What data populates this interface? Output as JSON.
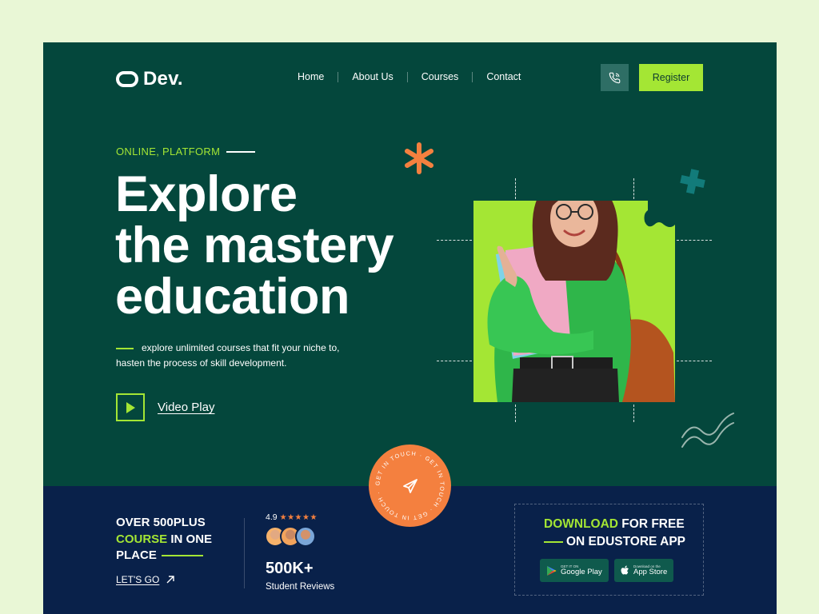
{
  "brand": {
    "name": "Dev."
  },
  "nav": {
    "items": [
      {
        "label": "Home"
      },
      {
        "label": "About Us"
      },
      {
        "label": "Courses"
      },
      {
        "label": "Contact"
      }
    ],
    "register_label": "Register"
  },
  "hero": {
    "eyebrow": "ONLINE, PLATFORM",
    "headline": [
      "Explore",
      "the mastery",
      "education"
    ],
    "subtext_line1": "explore unlimited courses that fit your niche to,",
    "subtext_line2": "hasten the  process of skill development.",
    "video_label": "Video Play",
    "badge_text": "GET IN TOUCH · GET IN TOUCH · GET IN TOUCH ·"
  },
  "stats": {
    "title_line1": "OVER 500PLUS",
    "title_accent": "COURSE",
    "title_rest": " IN ONE",
    "title_line3": "PLACE",
    "cta": "LET'S GO",
    "rating": "4.9",
    "stars": "★★★★★",
    "count": "500K+",
    "count_label": "Student Reviews"
  },
  "download": {
    "accent": "DOWNLOAD",
    "title_rest": " FOR FREE",
    "line2": "ON EDUSTORE APP",
    "google_small": "GET IT ON",
    "google_big": "Google Play",
    "apple_small": "Download on the",
    "apple_big": "App Store"
  },
  "colors": {
    "frame_bg": "#04473c",
    "band_bg": "#09214a",
    "accent_green": "#a4e634",
    "accent_orange": "#f4803f",
    "page_bg": "#e9f7d6"
  },
  "icons": [
    "phone-icon",
    "play-icon",
    "arrow-right-icon",
    "paper-plane-icon",
    "google-play-icon",
    "apple-icon",
    "asterisk-icon",
    "plus-icon",
    "squiggle-icon"
  ]
}
